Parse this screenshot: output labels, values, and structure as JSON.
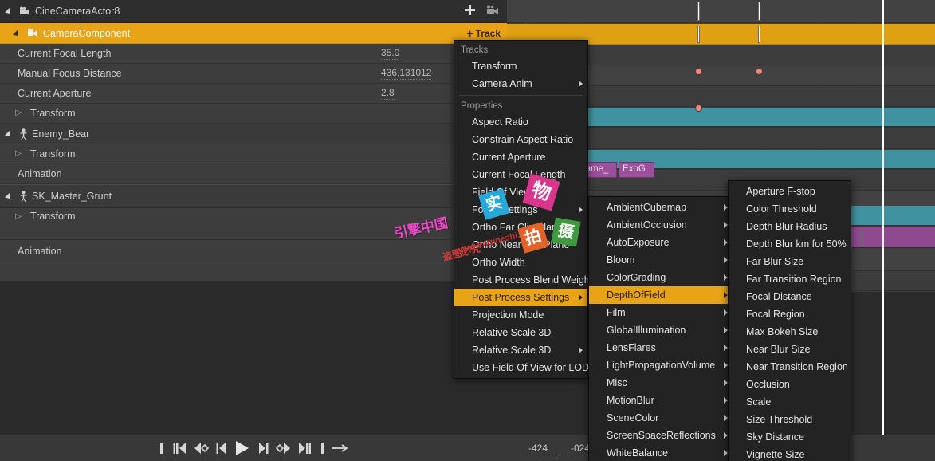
{
  "outliner": {
    "actor_header": {
      "label": "CineCameraActor8",
      "add_icon": "plus-icon",
      "camera_icon": "camera-icon"
    },
    "rows": [
      {
        "label": "CameraComponent",
        "icon": "camera-icon",
        "state": "selected",
        "track_button": "Track",
        "track_plus": "+"
      },
      {
        "label": "Current Focal Length",
        "value": "35.0"
      },
      {
        "label": "Manual Focus Distance",
        "value": "436.131012"
      },
      {
        "label": "Current Aperture",
        "value": "2.8"
      },
      {
        "label": "Transform"
      },
      {
        "label": "Enemy_Bear",
        "icon": "skeleton-icon"
      },
      {
        "label": "Transform"
      },
      {
        "label": "Animation"
      },
      {
        "label": "SK_Master_Grunt",
        "icon": "skeleton-icon"
      },
      {
        "label": "Transform"
      },
      {
        "label": "Animation"
      }
    ]
  },
  "timeline": {
    "section_chips": [
      {
        "label": "Same_"
      },
      {
        "label": "ExoG"
      }
    ],
    "colors": {
      "selected_track": "#e0a014",
      "teal_track": "#3f93a0",
      "purple_track": "#8f4a8f",
      "keyframe": "#ef8a80",
      "playhead": "#ffffff"
    }
  },
  "transport": {
    "buttons": [
      {
        "name": "jump-to-start-button",
        "glyph": "start"
      },
      {
        "name": "step-back-frames-button",
        "glyph": "prev-multi"
      },
      {
        "name": "previous-key-button",
        "glyph": "prev-key"
      },
      {
        "name": "step-back-button",
        "glyph": "prev"
      },
      {
        "name": "play-button",
        "glyph": "play"
      },
      {
        "name": "step-forward-button",
        "glyph": "next"
      },
      {
        "name": "next-key-button",
        "glyph": "next-key"
      },
      {
        "name": "step-forward-frames-button",
        "glyph": "next-multi"
      },
      {
        "name": "jump-to-end-button",
        "glyph": "end"
      },
      {
        "name": "loop-button",
        "glyph": "arrow"
      }
    ],
    "time_start": "-424",
    "time_end": "-024"
  },
  "menu_track": {
    "section_tracks": "Tracks",
    "section_properties": "Properties",
    "tracks_items": [
      {
        "label": "Transform",
        "submenu": false
      },
      {
        "label": "Camera Anim",
        "submenu": true
      }
    ],
    "properties_items": [
      {
        "label": "Aspect Ratio",
        "submenu": false
      },
      {
        "label": "Constrain Aspect Ratio",
        "submenu": false
      },
      {
        "label": "Current Aperture",
        "submenu": false
      },
      {
        "label": "Current Focal Length",
        "submenu": false
      },
      {
        "label": "Field Of View",
        "submenu": false
      },
      {
        "label": "Focus Settings",
        "submenu": true
      },
      {
        "label": "Ortho Far Clip Plane",
        "submenu": false
      },
      {
        "label": "Ortho Near Clip Plane",
        "submenu": false
      },
      {
        "label": "Ortho Width",
        "submenu": false
      },
      {
        "label": "Post Process Blend Weight",
        "submenu": false
      },
      {
        "label": "Post Process Settings",
        "submenu": true,
        "highlight": true
      },
      {
        "label": "Projection Mode",
        "submenu": false
      },
      {
        "label": "Relative Scale 3D",
        "submenu": false
      },
      {
        "label": "Relative Scale 3D",
        "submenu": true
      },
      {
        "label": "Use Field Of View for LOD",
        "submenu": false
      }
    ]
  },
  "menu_post_process": {
    "items": [
      {
        "label": "AmbientCubemap",
        "submenu": true
      },
      {
        "label": "AmbientOcclusion",
        "submenu": true
      },
      {
        "label": "AutoExposure",
        "submenu": true
      },
      {
        "label": "Bloom",
        "submenu": true
      },
      {
        "label": "ColorGrading",
        "submenu": true
      },
      {
        "label": "DepthOfField",
        "submenu": true,
        "highlight": true
      },
      {
        "label": "Film",
        "submenu": true
      },
      {
        "label": "GlobalIllumination",
        "submenu": true
      },
      {
        "label": "LensFlares",
        "submenu": true
      },
      {
        "label": "LightPropagationVolume",
        "submenu": true
      },
      {
        "label": "Misc",
        "submenu": true
      },
      {
        "label": "MotionBlur",
        "submenu": true
      },
      {
        "label": "SceneColor",
        "submenu": true
      },
      {
        "label": "ScreenSpaceReflections",
        "submenu": true
      },
      {
        "label": "WhiteBalance",
        "submenu": true
      }
    ]
  },
  "menu_depth_of_field": {
    "items": [
      {
        "label": "Aperture F-stop"
      },
      {
        "label": "Color Threshold"
      },
      {
        "label": "Depth Blur Radius"
      },
      {
        "label": "Depth Blur km for 50%"
      },
      {
        "label": "Far Blur Size"
      },
      {
        "label": "Far Transition Region"
      },
      {
        "label": "Focal Distance"
      },
      {
        "label": "Focal Region"
      },
      {
        "label": "Max Bokeh Size"
      },
      {
        "label": "Near Blur Size"
      },
      {
        "label": "Near Transition Region"
      },
      {
        "label": "Occlusion"
      },
      {
        "label": "Scale"
      },
      {
        "label": "Size Threshold"
      },
      {
        "label": "Sky Distance"
      },
      {
        "label": "Vignette Size"
      }
    ]
  },
  "watermarks": {
    "site_text": "www.engineshi.com",
    "cn_brand": "引擎中国",
    "tags": [
      "实",
      "物",
      "拍",
      "摄"
    ],
    "tagline": "盗图必究"
  }
}
